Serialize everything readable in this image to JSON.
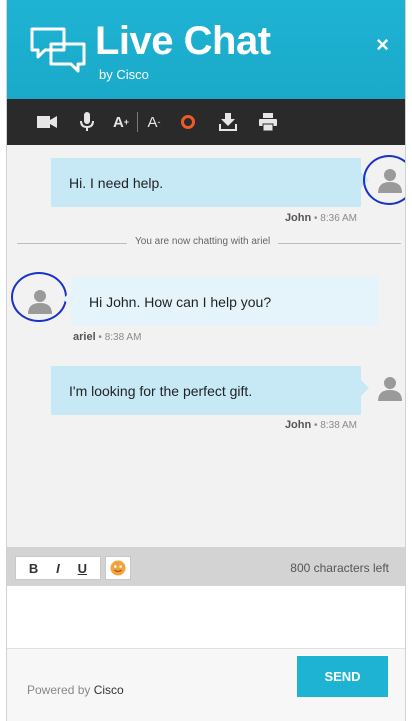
{
  "header": {
    "title": "Live Chat",
    "subtitle": "by Cisco",
    "close_label": "×",
    "accent_color": "#1fb3d3"
  },
  "toolbar": {
    "items": [
      "video-camera-icon",
      "microphone-icon",
      "font-increase-icon",
      "font-decrease-icon",
      "record-circle-icon",
      "download-icon",
      "print-icon"
    ],
    "font_increase_label": "A",
    "font_increase_sup": "+",
    "font_decrease_label": "A",
    "font_decrease_sup": "-"
  },
  "messages": [
    {
      "direction": "out",
      "text": "Hi. I need help.",
      "author": "John",
      "time": "8:36 AM"
    },
    {
      "direction": "in",
      "text": "Hi John. How can I help you?",
      "author": "ariel",
      "time": "8:38 AM"
    },
    {
      "direction": "out",
      "text": "I'm looking for the perfect gift.",
      "author": "John",
      "time": "8:38 AM"
    }
  ],
  "system_notice": "You are now chatting with ariel",
  "meta_separator": "•",
  "format_bar": {
    "bold": "B",
    "italic": "I",
    "underline": "U",
    "emoji_icon": "emoji-icon",
    "chars_left": "800 characters left"
  },
  "input": {
    "value": "",
    "placeholder": ""
  },
  "footer": {
    "powered_prefix": "Powered by",
    "powered_brand": "Cisco",
    "send_label": "SEND"
  }
}
